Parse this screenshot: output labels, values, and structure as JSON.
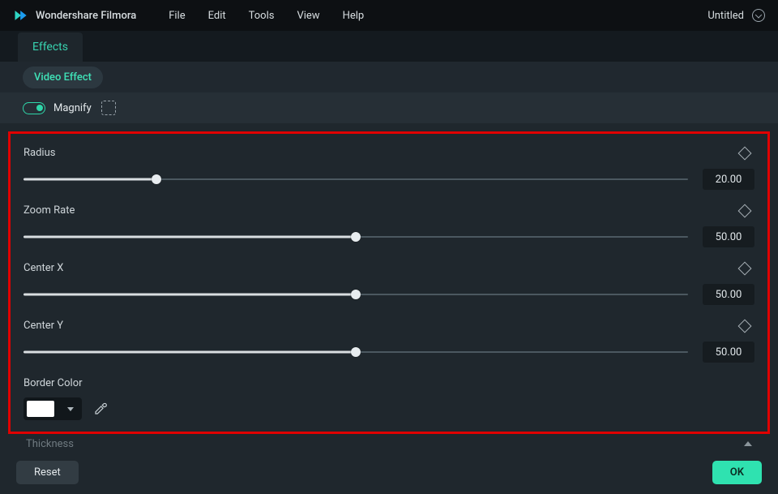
{
  "app": {
    "name": "Wondershare Filmora"
  },
  "menubar": {
    "items": [
      "File",
      "Edit",
      "Tools",
      "View",
      "Help"
    ]
  },
  "document": {
    "title": "Untitled"
  },
  "tabs": {
    "active": "Effects"
  },
  "effect_chip": "Video Effect",
  "toggle_row": {
    "label": "Magnify",
    "enabled": true
  },
  "params": [
    {
      "label": "Radius",
      "value": "20.00",
      "percent": 20
    },
    {
      "label": "Zoom Rate",
      "value": "50.00",
      "percent": 50
    },
    {
      "label": "Center X",
      "value": "50.00",
      "percent": 50
    },
    {
      "label": "Center Y",
      "value": "50.00",
      "percent": 50
    }
  ],
  "border_color": {
    "label": "Border Color",
    "swatch": "#FFFFFF"
  },
  "next_section_label": "Thickness",
  "footer": {
    "reset": "Reset",
    "ok": "OK"
  }
}
